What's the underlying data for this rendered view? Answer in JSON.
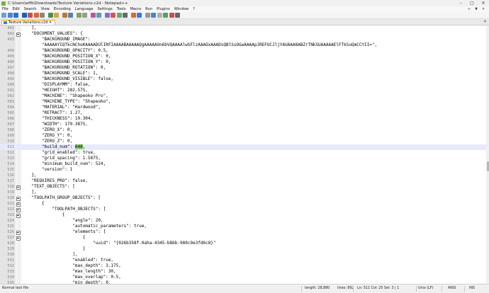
{
  "window": {
    "title": "C:\\Users\\wffb\\Downloads\\Texture Variations.c2d - Notepad++",
    "controls": [
      "–",
      "□",
      "✕"
    ]
  },
  "menu": {
    "items": [
      "File",
      "Edit",
      "Search",
      "View",
      "Encoding",
      "Language",
      "Settings",
      "Tools",
      "Macro",
      "Run",
      "Plugins",
      "Window",
      "?"
    ],
    "right": [
      "+",
      "▼",
      "✕"
    ]
  },
  "toolbar": {
    "colors": [
      "#6aa0d8",
      "#4f84c9",
      "#2e6fc4",
      "#1f5fb0",
      "#c94f4f",
      "#d06b3d",
      "#888888",
      "#4b8f4b",
      "#d9a441",
      "#b37a3a",
      "#5a7fb0",
      "#7fa35a",
      "#999999",
      "#b05a9e",
      "#5a9eb0",
      "#8a6ad0",
      "#c95a5a",
      "#5ab06a",
      "#6a6a6a",
      "#d06b3d",
      "#3a7bd5",
      "#999999",
      "#4f84c9",
      "#b0b0b0",
      "#5a9e5a",
      "#c94f4f",
      "#666666"
    ]
  },
  "tabs": [
    {
      "label": "Texture Variations.c2d ✕"
    }
  ],
  "tab_end": "▾",
  "editor": {
    "current_line": 511,
    "lines": [
      {
        "n": "491",
        "text": "    ],"
      },
      {
        "n": "492",
        "text": "    \"DOCUMENT_VALUES\": {",
        "fold": true
      },
      {
        "n": "493",
        "text": "        \"BACKGROUND_IMAGE\":"
      },
      {
        "n": "",
        "text": "        \"AAAAAYIQTkcNChoKAAAADUlIRFIAAAABAAAAAQgAAAAAOn6bVQAAAAlwSFlzAAAOxAAADsQBlSsOGwAAAApJREFUCJljYAUAAA8ABZrTNkSUAAAAAElFTkSuQmCCYII=\","
      },
      {
        "n": "494",
        "text": "        \"BACKGROUND_OPACITY\": 0.5,"
      },
      {
        "n": "495",
        "text": "        \"BACKGROUND_POSITION_X\": 0,"
      },
      {
        "n": "496",
        "text": "        \"BACKGROUND_POSITION_Y\": 0,"
      },
      {
        "n": "497",
        "text": "        \"BACKGROUND_ROTATION\": 0,"
      },
      {
        "n": "498",
        "text": "        \"BACKGROUND_SCALE\": 1,"
      },
      {
        "n": "499",
        "text": "        \"BACKGROUND_VISIBLE\": false,"
      },
      {
        "n": "500",
        "text": "        \"DISPLAYMM\": false,"
      },
      {
        "n": "501",
        "text": "        \"HEIGHT\": 282.575,"
      },
      {
        "n": "502",
        "text": "        \"MACHINE\": \"Shapeoko Pro\","
      },
      {
        "n": "503",
        "text": "        \"MACHINE_TYPE\": \"Shapeoko\","
      },
      {
        "n": "504",
        "text": "        \"MATERIAL\": \"Hardwood\","
      },
      {
        "n": "505",
        "text": "        \"RETRACT\": 1.27,"
      },
      {
        "n": "506",
        "text": "        \"THICKNESS\": 19.304,"
      },
      {
        "n": "507",
        "text": "        \"WIDTH\": 179.3875,"
      },
      {
        "n": "508",
        "text": "        \"ZERO_X\": 0,"
      },
      {
        "n": "509",
        "text": "        \"ZERO_Y\": 0,"
      },
      {
        "n": "510",
        "text": "        \"ZERO_Z\": 0,"
      },
      {
        "n": "511",
        "pre": "        \"build_num\": ",
        "hl": "648",
        "post": ","
      },
      {
        "n": "512",
        "text": "        \"grid_enabled\": true,"
      },
      {
        "n": "513",
        "text": "        \"grid_spacing\": 1.5875,"
      },
      {
        "n": "514",
        "text": "        \"minimum_build_num\": 524,"
      },
      {
        "n": "515",
        "text": "        \"version\": 1"
      },
      {
        "n": "516",
        "text": "    },"
      },
      {
        "n": "517",
        "text": "    \"REQUIRES_PRO\": false,"
      },
      {
        "n": "518",
        "text": "    \"TEXT_OBJECTS\": [",
        "fold": true
      },
      {
        "n": "519",
        "text": "    ],"
      },
      {
        "n": "520",
        "text": "    \"TOOLPATH_GROUP_OBJECTS\": [",
        "fold": true
      },
      {
        "n": "521",
        "text": "        {",
        "fold": true
      },
      {
        "n": "522",
        "text": "            \"TOOLPATH_OBJECTS\": [",
        "fold": true
      },
      {
        "n": "523",
        "text": "                {",
        "fold": true
      },
      {
        "n": "524",
        "text": "                    \"angle\": 20,"
      },
      {
        "n": "525",
        "text": "                    \"automatic_parameters\": true,"
      },
      {
        "n": "526",
        "text": "                    \"elements\": [",
        "fold": true
      },
      {
        "n": "527",
        "text": "                        {",
        "fold": true
      },
      {
        "n": "528",
        "text": "                            \"uuid\": \"{026b358f-0aha-4345-b8bb-980c9e3fd6c8}\""
      },
      {
        "n": "529",
        "text": "                        }"
      },
      {
        "n": "530",
        "text": "                    ],"
      },
      {
        "n": "531",
        "text": "                    \"enabled\": true,"
      },
      {
        "n": "532",
        "text": "                    \"max_depth\": 3.175,"
      },
      {
        "n": "533",
        "text": "                    \"max_length\": 30,"
      },
      {
        "n": "534",
        "text": "                    \"max_overlap\": 0.5,"
      },
      {
        "n": "535",
        "text": "                    \"min_depth\": 0,"
      }
    ]
  },
  "status": {
    "type": "Normal text file",
    "length": "length: 28,880",
    "lines": "lines: 892",
    "pos": "Ln: 511   Col: 25   Sel: 3 | 1",
    "eol": "Unix (LF)",
    "enc": "ANSI",
    "mode": "INS"
  }
}
